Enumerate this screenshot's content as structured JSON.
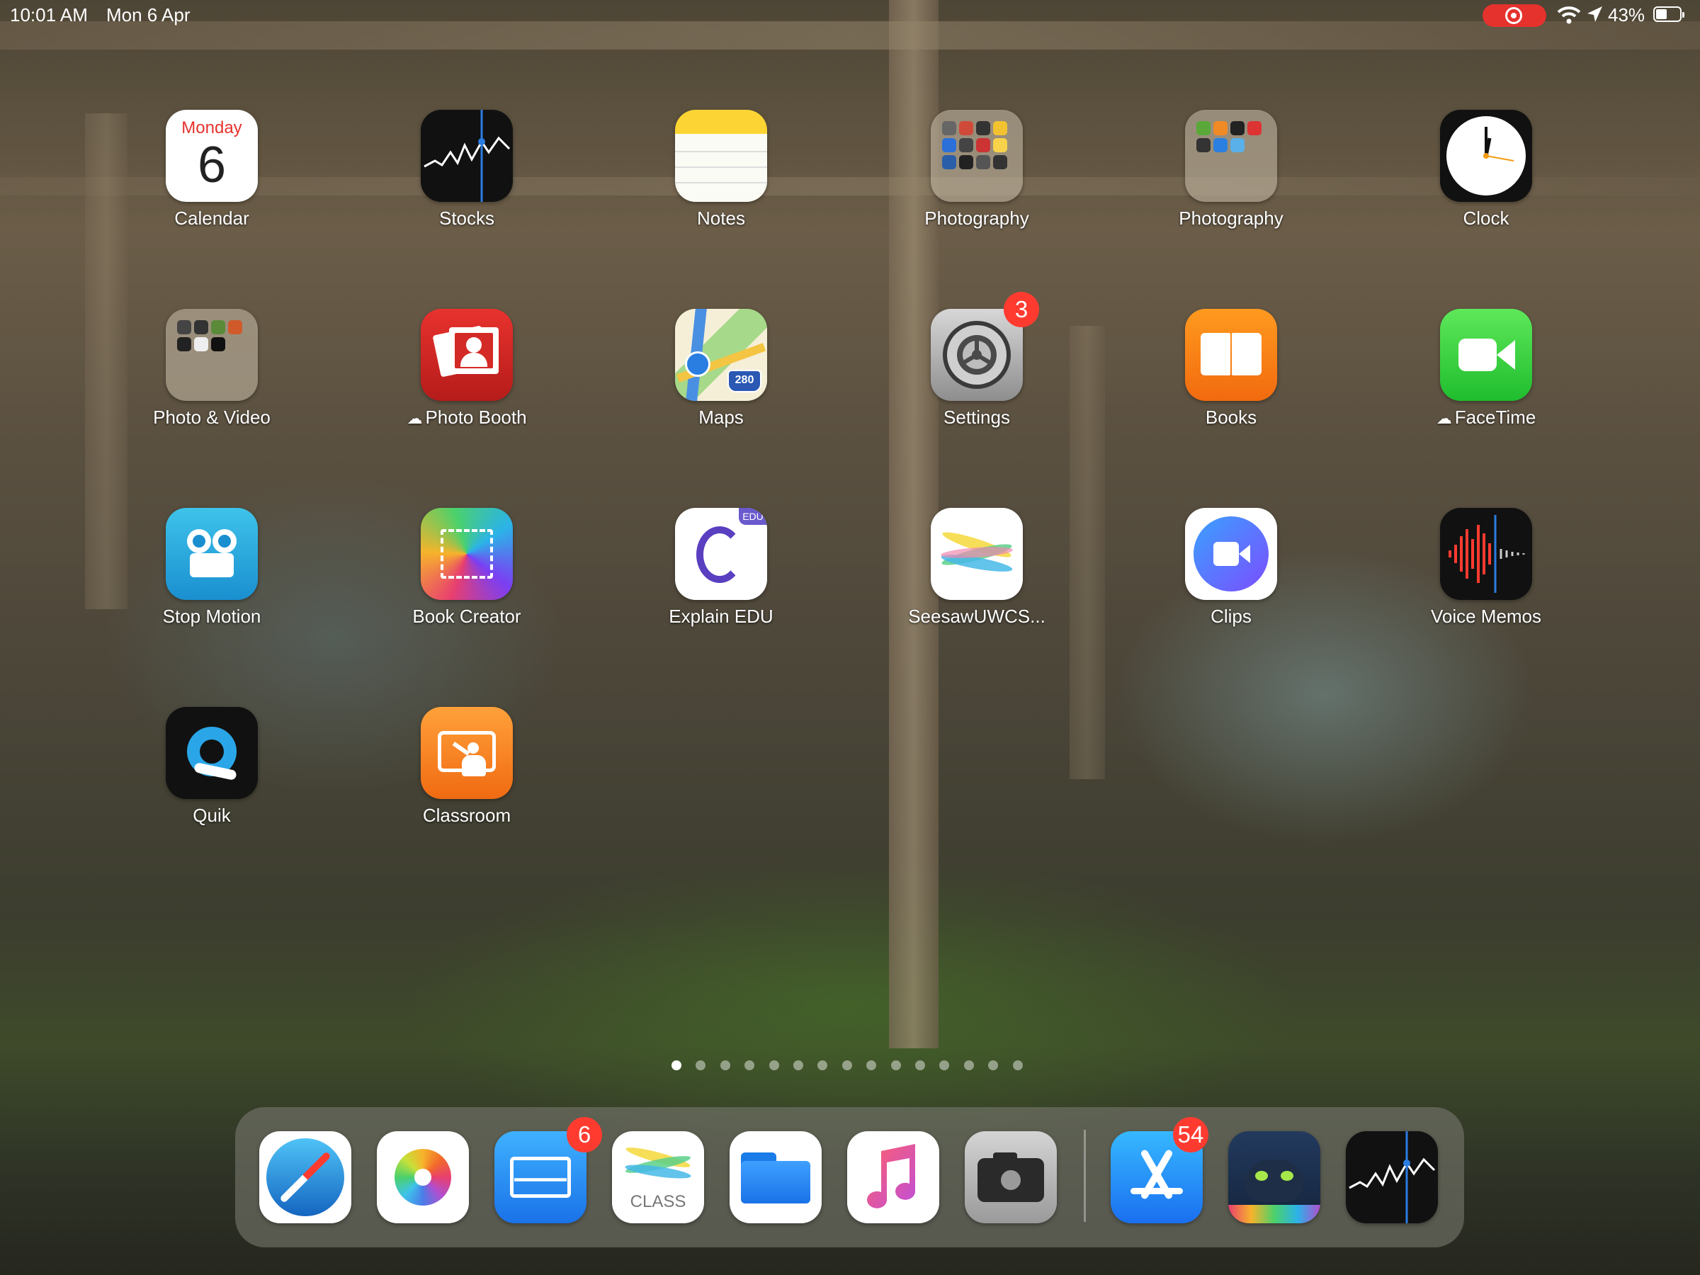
{
  "status_bar": {
    "time": "10:01 AM",
    "date": "Mon 6 Apr",
    "battery": "43%"
  },
  "calendar": {
    "weekday": "Monday",
    "day": "6"
  },
  "apps": [
    {
      "label": "Calendar",
      "icon": "calendar-icon"
    },
    {
      "label": "Stocks",
      "icon": "stocks-icon"
    },
    {
      "label": "Notes",
      "icon": "notes-icon"
    },
    {
      "label": "Photography",
      "icon": "folder-icon"
    },
    {
      "label": "Photography",
      "icon": "folder-icon"
    },
    {
      "label": "Clock",
      "icon": "clock-icon"
    },
    {
      "label": "Photo & Video",
      "icon": "folder-icon"
    },
    {
      "label": "Photo Booth",
      "icon": "photo-booth-icon",
      "cloud": true
    },
    {
      "label": "Maps",
      "icon": "maps-icon"
    },
    {
      "label": "Settings",
      "icon": "settings-icon",
      "badge": "3"
    },
    {
      "label": "Books",
      "icon": "books-icon"
    },
    {
      "label": "FaceTime",
      "icon": "facetime-icon",
      "cloud": true
    },
    {
      "label": "Stop Motion",
      "icon": "stop-motion-icon"
    },
    {
      "label": "Book Creator",
      "icon": "book-creator-icon"
    },
    {
      "label": "Explain EDU",
      "icon": "explain-edu-icon"
    },
    {
      "label": "SeesawUWCS...",
      "icon": "seesaw-icon"
    },
    {
      "label": "Clips",
      "icon": "clips-icon"
    },
    {
      "label": "Voice Memos",
      "icon": "voice-memos-icon"
    },
    {
      "label": "Quik",
      "icon": "quik-icon"
    },
    {
      "label": "Classroom",
      "icon": "classroom-icon"
    }
  ],
  "maps_badge": "280",
  "explain_tag": "EDU",
  "cloud_glyph": "☁",
  "page_dots": {
    "count": 15,
    "active": 0
  },
  "dock": [
    {
      "icon": "safari-icon"
    },
    {
      "icon": "photos-icon"
    },
    {
      "icon": "mail-icon",
      "badge": "6"
    },
    {
      "icon": "seesaw-class-icon",
      "text": "CLASS"
    },
    {
      "icon": "files-icon"
    },
    {
      "icon": "music-icon"
    },
    {
      "icon": "camera-icon"
    },
    {
      "icon": "app-store-icon",
      "badge": "54"
    },
    {
      "icon": "game-icon"
    },
    {
      "icon": "stocks-icon"
    }
  ]
}
